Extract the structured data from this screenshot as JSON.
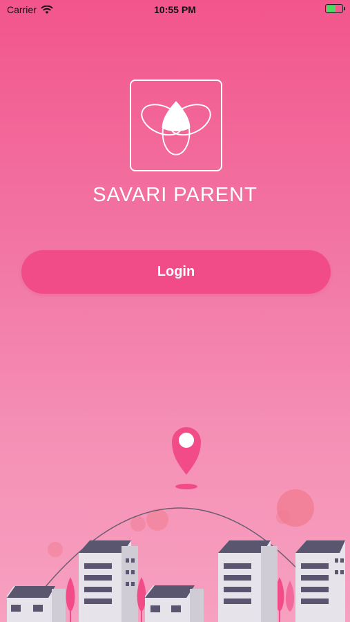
{
  "status_bar": {
    "carrier": "Carrier",
    "time": "10:55 PM",
    "wifi_icon": "wifi-icon",
    "battery_icon": "battery-charging-icon"
  },
  "app": {
    "name": "SAVARI PARENT",
    "logo_icon": "trefoil-logo-icon"
  },
  "login": {
    "label": "Login"
  },
  "illustration": {
    "pin_icon": "map-pin-icon",
    "scene": "city-buildings"
  },
  "colors": {
    "primary": "#f24c88",
    "background_top": "#f2558c",
    "background_bottom": "#f7a0c0",
    "building_roof": "#5b5670",
    "building_wall": "#e6e3ea"
  }
}
